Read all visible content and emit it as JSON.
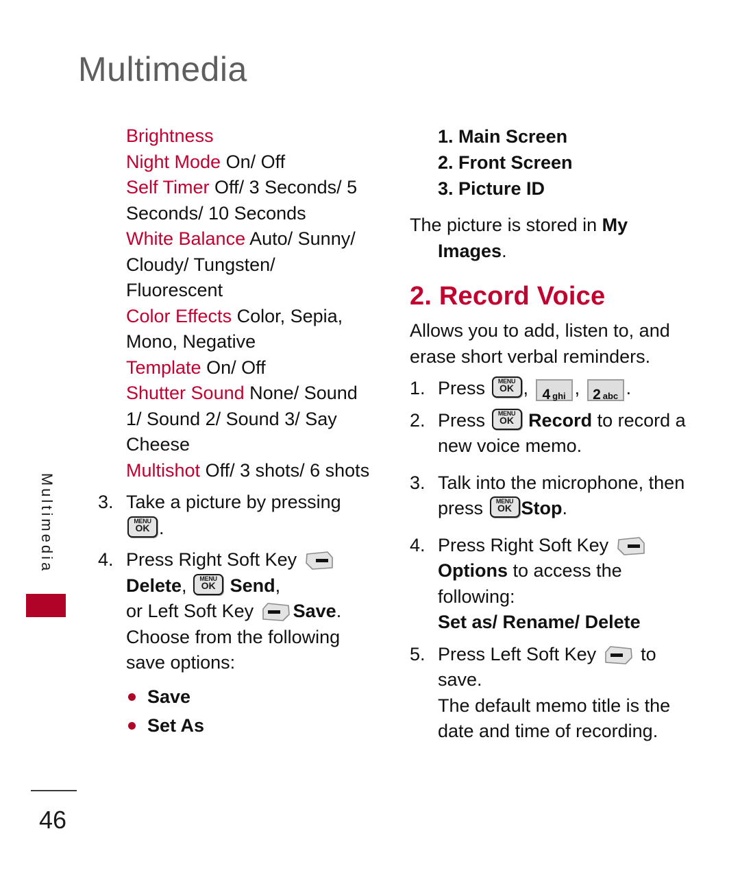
{
  "page": {
    "chapter_title": "Multimedia",
    "side_tab_label": "Multimedia",
    "page_number": "46",
    "accent_color": "#c10230",
    "tab_color": "#b00327",
    "title_color": "#5e5e5e"
  },
  "icons": {
    "menu_ok": {
      "name": "menu-ok-key-icon",
      "top_label": "MENU",
      "bottom_label": "OK"
    },
    "right_soft_key": {
      "name": "right-soft-key-icon"
    },
    "left_soft_key": {
      "name": "left-soft-key-icon"
    },
    "key_4": {
      "name": "keypad-key-4-icon",
      "digit": "4",
      "letters": "ghi"
    },
    "key_2": {
      "name": "keypad-key-2-icon",
      "digit": "2",
      "letters": "abc"
    }
  },
  "left_column": {
    "settings": [
      {
        "name": "Brightness",
        "values": ""
      },
      {
        "name": "Night Mode",
        "values": "On/ Off"
      },
      {
        "name": "Self Timer",
        "values": "Off/ 3 Seconds/ 5 Seconds/ 10 Seconds"
      },
      {
        "name": "White Balance",
        "values": "Auto/ Sunny/ Cloudy/ Tungsten/ Fluorescent"
      },
      {
        "name": "Color Effects",
        "values": "Color, Sepia, Mono, Negative"
      },
      {
        "name": "Template",
        "values": "On/ Off"
      },
      {
        "name": "Shutter Sound",
        "values": "None/ Sound 1/ Sound 2/ Sound 3/ Say Cheese"
      },
      {
        "name": "Multishot",
        "values": "Off/ 3 shots/ 6 shots"
      }
    ],
    "step3": {
      "number": "3.",
      "text_before": "Take a picture by pressing",
      "text_after": "."
    },
    "step4": {
      "number": "4.",
      "line1_before": "Press Right Soft Key",
      "line2_delete": "Delete",
      "line2_comma": ",",
      "line2_send": "Send",
      "line2_send_comma": ",",
      "line3_before": "or Left Soft Key",
      "line3_save": "Save",
      "line3_period": ".",
      "line4": "Choose from the following",
      "line5": "save options:"
    },
    "bullets": [
      "Save",
      "Set As"
    ]
  },
  "right_column": {
    "numbered_items": [
      "1. Main Screen",
      "2. Front Screen",
      "3. Picture ID"
    ],
    "stored_note": {
      "line1_plain": "The picture is stored in ",
      "line1_bold": "My",
      "line2_bold": "Images",
      "line2_period": "."
    },
    "section": {
      "heading": "2. Record Voice",
      "intro": "Allows you to add, listen to, and erase short verbal reminders."
    },
    "steps": {
      "step1": {
        "number": "1.",
        "text_press": "Press",
        "comma1": ",",
        "comma2": ",",
        "period": "."
      },
      "step2": {
        "number": "2.",
        "text_press": "Press",
        "bold_label": "Record",
        "text_after": "to record a",
        "line2": "new voice memo."
      },
      "step3": {
        "number": "3.",
        "line1": "Talk into the microphone, then",
        "line2_press": "press",
        "line2_bold": "Stop",
        "line2_period": "."
      },
      "step4": {
        "number": "4.",
        "line1": "Press Right Soft Key",
        "line2_bold": "Options",
        "line2_after": "to access the",
        "line3": "following:",
        "line4_bold": "Set as/ Rename/ Delete"
      },
      "step5": {
        "number": "5.",
        "line1_before": "Press Left Soft Key",
        "line1_after": "to save.",
        "line2": "The default memo title is the",
        "line3": "date and time of recording."
      }
    }
  }
}
